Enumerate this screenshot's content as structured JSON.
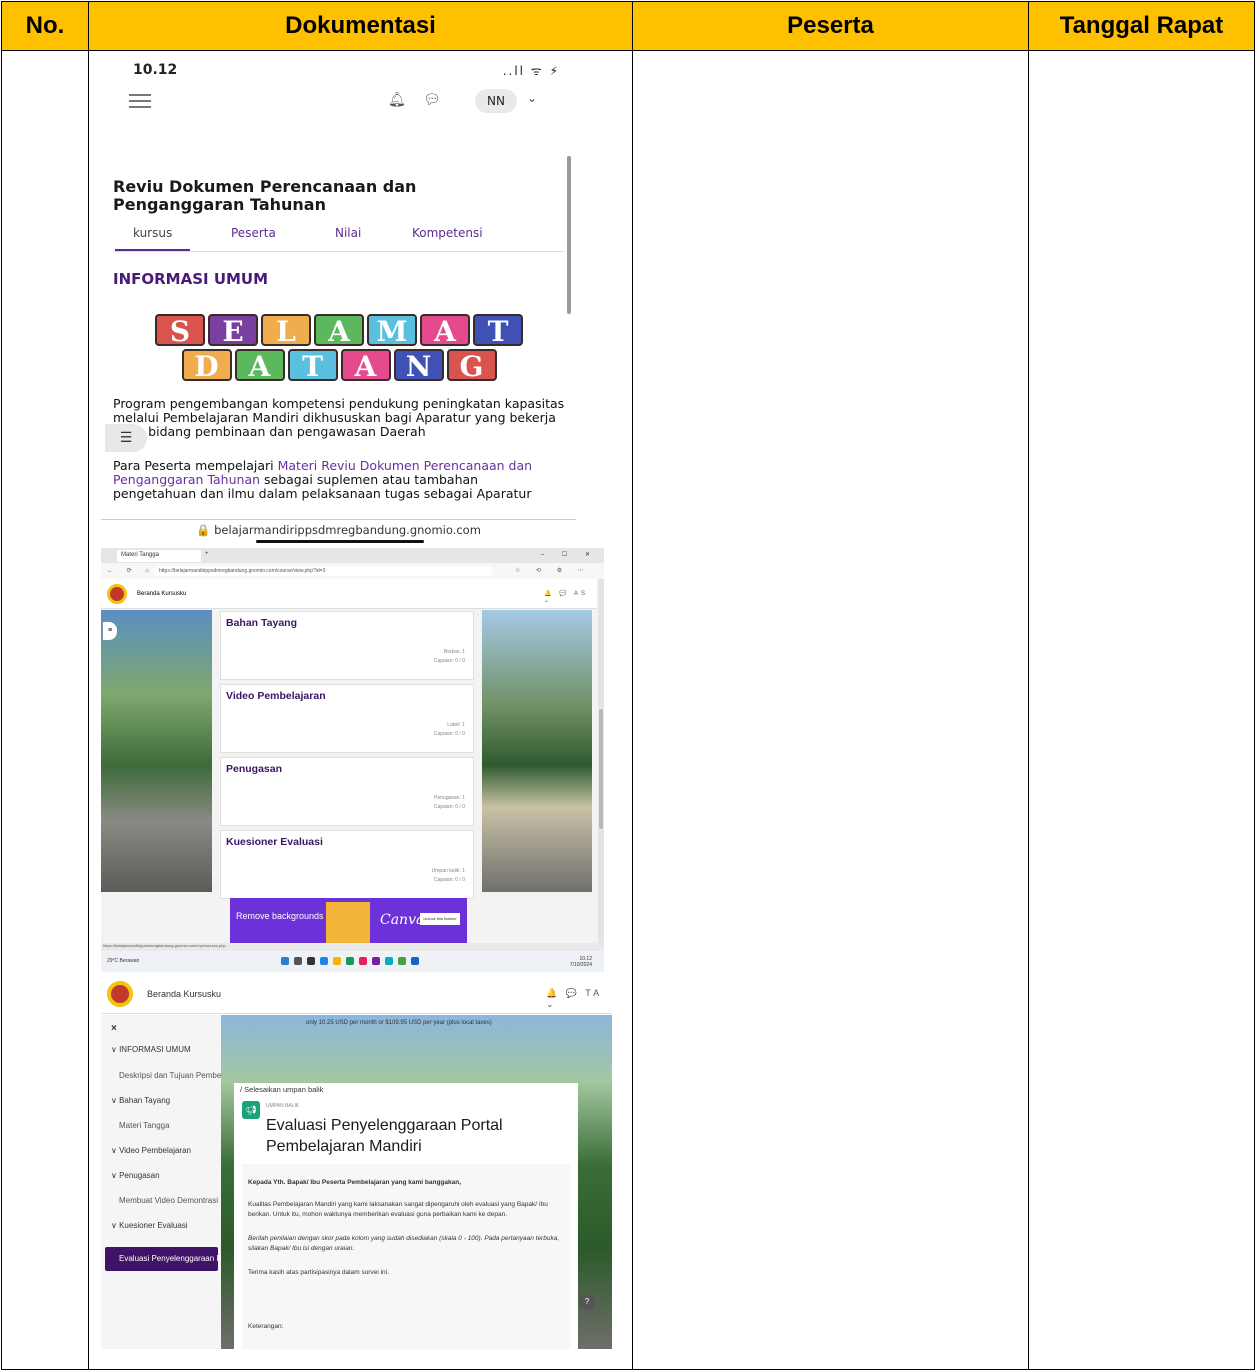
{
  "table": {
    "headers": {
      "no": "No.",
      "dokumentasi": "Dokumentasi",
      "peserta": "Peserta",
      "tanggal": "Tanggal Rapat"
    },
    "header_color": "#ffc000"
  },
  "phone": {
    "time": "10.12",
    "signal": "..ll ᯤ ⚡",
    "bell_icon": "bell-icon",
    "chat_icon": "chat-icon",
    "avatar": "NN",
    "caret": "⌄",
    "title": "Reviu Dokumen Perencanaan dan Penganggaran Tahunan",
    "tabs": [
      "kursus",
      "Peserta",
      "Nilai",
      "Kompetensi"
    ],
    "section": "INFORMASI UMUM",
    "banner_row1": [
      "S",
      "E",
      "L",
      "A",
      "M",
      "A",
      "T"
    ],
    "banner_row2": [
      "D",
      "A",
      "T",
      "A",
      "N",
      "G"
    ],
    "paragraph1": "Program pengembangan kompetensi pendukung peningkatan kapasitas melalui Pembelajaran Mandiri dikhususkan bagi Aparatur yang bekerja pada bidang pembinaan dan pengawasan Daerah",
    "paragraph2_a": "Para Peserta mempelajari ",
    "paragraph2_link": "Materi Reviu Dokumen Perencanaan dan Penganggaran Tahunan",
    "paragraph2_b": " sebagai suplemen atau tambahan pengetahuan dan ilmu dalam pelaksanaan tugas sebagai Aparatur",
    "url": "🔒 belajarmandirippsdmregbandung.gnomio.com"
  },
  "desktop": {
    "tab_title": "Materi Tangga",
    "plus": "+",
    "window_controls": "– ☐ ✕",
    "nav": "← ⟳ ⌂",
    "address": "https://belajarmandirippsdmregbandung.gnomio.com/course/view.php?id=3",
    "extensions": "☆ ⟲ ⚙ ⋯",
    "menu": "Beranda  Kursusku",
    "right": "🔔 💬 AS ⌄",
    "toggle": "≡",
    "cards": [
      {
        "title": "Bahan Tayang",
        "meta1": "Berkas: 1",
        "meta2": "Capaian: 0 / 0"
      },
      {
        "title": "Video Pembelajaran",
        "meta1": "Label: 1",
        "meta2": "Capaian: 0 / 0"
      },
      {
        "title": "Penugasan",
        "meta1": "Penugasan: 1",
        "meta2": "Capaian: 0 / 0"
      },
      {
        "title": "Kuesioner Evaluasi",
        "meta1": "Umpan balik: 1",
        "meta2": "Capaian: 0 / 0"
      }
    ],
    "ad_text": "Remove backgrounds in a click",
    "ad_brand": "Canva",
    "ad_button": "Unlock this feature",
    "status_url": "https://belajarmandirippsdmregbandung.gnomio.com/my/courses.php",
    "weather": "29°C Berawan",
    "clock": "10.12",
    "date": "7/10/2024"
  },
  "feedback": {
    "menu": "Beranda  Kursusku",
    "right": "🔔 💬 TA ⌄",
    "close": "×",
    "sidebar": [
      {
        "label": "∨  INFORMASI UMUM",
        "kind": "it"
      },
      {
        "label": "Deskripsi dan Tujuan Pembel...",
        "kind": "sub"
      },
      {
        "label": "∨  Bahan Tayang",
        "kind": "it"
      },
      {
        "label": "Materi Tangga",
        "kind": "sub"
      },
      {
        "label": "∨  Video Pembelajaran",
        "kind": "it"
      },
      {
        "label": "∨  Penugasan",
        "kind": "it"
      },
      {
        "label": "Membuat Video Demontrasi",
        "kind": "sub"
      },
      {
        "label": "∨  Kuesioner Evaluasi",
        "kind": "it"
      },
      {
        "label": "Evaluasi Penyelenggaraan Po...",
        "kind": "act"
      }
    ],
    "top_note": "only 10.25 USD per month or $109.95 USD per year (plus local taxes)",
    "breadcrumb": "/  Selesaikan umpan balik",
    "tag": "UMPAN BALIK",
    "title": "Evaluasi Penyelenggaraan Portal Pembelajaran Mandiri",
    "greeting": "Kepada Yth. Bapak/ Ibu Peserta Pembelajaran yang kami banggakan,",
    "body1": "Kualitas Pembelajaran Mandiri yang kami laksanakan sangat dipengaruhi oleh evaluasi yang Bapak/ Ibu berikan. Untuk itu, mohon waktunya memberikan evaluasi guna perbaikan kami ke depan.",
    "body2": "Berilah penilaian dengan skor pada kolom yang sudah disediakan (skala 0 - 100). Pada pertanyaan terbuka, silakan Bapak/ Ibu isi dengan uraian.",
    "body3": "Terima kasih atas partisipasinya dalam survei ini.",
    "body4": "Keterangan:",
    "help": "?"
  }
}
